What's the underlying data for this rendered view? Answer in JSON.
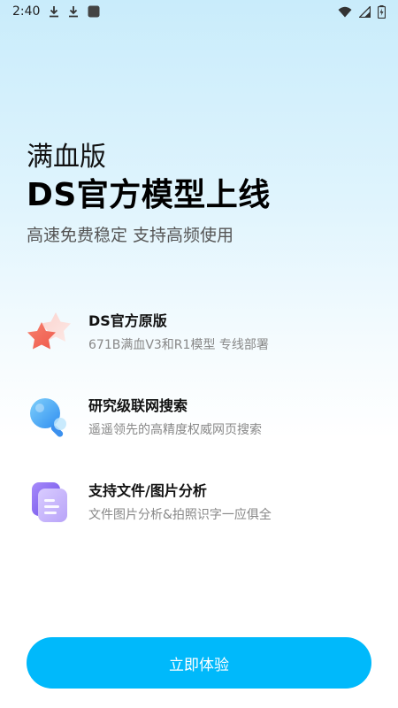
{
  "status_bar": {
    "time": "2:40",
    "icons_left": [
      "download-icon",
      "download-icon",
      "app-square-icon"
    ],
    "icons_right": [
      "wifi-icon",
      "signal-icon",
      "battery-charging-icon"
    ]
  },
  "hero": {
    "subtitle": "满血版",
    "title": "DS官方模型上线",
    "tagline": "高速免费稳定 支持高频使用"
  },
  "features": [
    {
      "icon": "stars-icon",
      "title": "DS官方原版",
      "desc": "671B满血V3和R1模型 专线部署"
    },
    {
      "icon": "magnifier-icon",
      "title": "研究级联网搜索",
      "desc": "遥遥领先的高精度权威网页搜索"
    },
    {
      "icon": "document-icon",
      "title": "支持文件/图片分析",
      "desc": "文件图片分析&拍照识字一应俱全"
    }
  ],
  "cta": {
    "label": "立即体验"
  },
  "colors": {
    "accent": "#00b9fb",
    "star": "#f26b5b",
    "search": "#3aa8f5",
    "doc": "#8b6cf2"
  }
}
